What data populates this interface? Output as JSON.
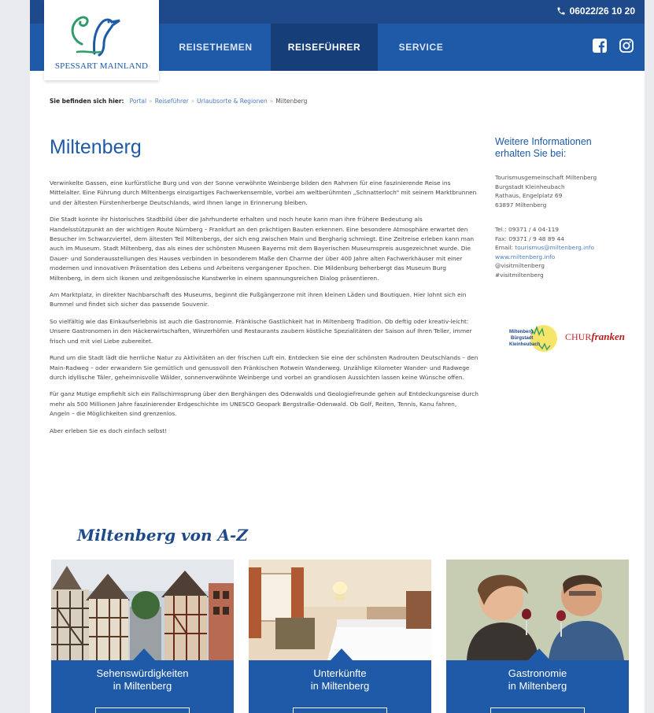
{
  "header": {
    "phone": "06022/26 10 20",
    "logo_text": "SPESSART MAINLAND",
    "nav": [
      {
        "label": "REISETHEMEN"
      },
      {
        "label": "REISEFÜHRER"
      },
      {
        "label": "SERVICE"
      }
    ],
    "icons": {
      "phone": "phone-icon",
      "facebook": "facebook-icon",
      "instagram": "instagram-icon"
    },
    "colors": {
      "topbar": "#1e4a8c",
      "navbar": "#1e5aa8",
      "active": "#163f7a"
    }
  },
  "breadcrumb": {
    "label": "Sie befinden sich hier:",
    "items": [
      "Portal",
      "Reiseführer",
      "Urlaubsorte & Regionen",
      "Miltenberg"
    ]
  },
  "main": {
    "title": "Miltenberg",
    "paragraphs": [
      "Verwinkelte Gassen, eine kurfürstliche Burg und von der Sonne verwöhnte Weinberge bilden den Rahmen für eine faszinierende Reise ins Mittelalter. Eine Führung durch Miltenbergs einzigartiges Fachwerkensemble, vorbei am weltberühmten „Schnatterloch\" mit seinem Marktbrunnen und der ältesten Fürstenherberge Deutschlands, wird Ihnen lange in Erinnerung bleiben.",
      "Die Stadt konnte ihr historisches Stadtbild über die Jahrhunderte erhalten und noch heute kann man ihre frühere Bedeutung als Handelsstützpunkt an der wichtigen Route Nürnberg – Frankfurt an den prächtigen Bauten erkennen. Eine besondere Atmosphäre erwartet den Besucher im Schwarzviertel, dem ältesten Teil Miltenbergs, der sich eng zwischen Main und Bergharig schmiegt. Eine Zeitreise erleben kann man auch im Museum. Stadt Miltenberg, das als eines der schönsten Museen Bayerns mit dem Bayerischen Museumspreis ausgezeichnet wurde. Die Dauer- und Sonderausstellungen des Hauses verbinden in besonderem Maße den Charme der über 400 Jahre alten Fachwerkhäuser mit einer modernen und innovativen Präsentation des Lebens und Arbeitens vergangener Epochen. Die Mildenburg beherbergt das Museum Burg Miltenberg, in dem sich Ikonen und zeitgenössische Kunstwerke in einem spannungsreichen Dialog präsentieren.",
      "Am Marktplatz, in direkter Nachbarschaft des Museums, beginnt die Fußgängerzone mit ihren kleinen Läden und Boutiquen. Hier lohnt sich ein Bummel und findet sich sicher das passende Souvenir.",
      "So vielfältig wie das Einkaufserlebnis ist auch die Gastronomie. Fränkische Gastlichkeit hat in Miltenberg Tradition. Ob deftig oder kreativ-leicht: Unsere Gastronomen in den Häckerwirtschaften, Winzerhöfen und Restaurants zaubern köstliche Spezialitäten der Saison auf Ihren Teller, immer frisch und mit viel Liebe zubereitet.",
      "Rund um die Stadt lädt die herrliche Natur zu Aktivitäten an der frischen Luft ein. Entdecken Sie eine der schönsten Radrouten Deutschlands – den Main-Radweg – oder erwandern Sie gemütlich und genussvoll den Fränkischen Rotwein Wanderweg. Unzählige Kilometer Wander- und Radwege durch idyllische Täler, geheimnisvolle Wälder, sonnenverwöhnte Weinberge und vorbei an grandiosen Aussichten lassen keine Wünsche offen.",
      "Für ganz Mutige empfiehlt sich ein Fallschirmsprung über den Berghängen des Odenwalds und Geologiefreunde gehen auf Entdeckungsreise durch mehr als 500 Millionen Jahre faszinierender Erdgeschichte im UNESCO Geopark Bergstraße-Odenwald. Ob Golf, Reiten, Tennis, Kanu fahren, Angeln – die Möglichkeiten sind grenzenlos.",
      "Aber erleben Sie es doch einfach selbst!"
    ]
  },
  "sidebar": {
    "title": "Weitere Informationen erhalten Sie bei:",
    "address": [
      "Tourismusgemeinschaft Miltenberg",
      "Burgstadt Kleinheubach",
      "Rathaus, Engelplatz 69",
      "63897 Miltenberg"
    ],
    "contact": {
      "tel": "Tel.: 09371 / 4 04-119",
      "fax": "Fax: 09371 / 9 48 89 44",
      "email_label": "Email:",
      "email": "tourismus@miltenberg.info",
      "web": "www.miltenberg.info",
      "handle1": "@visitmiltenberg",
      "handle2": "#visitmiltenberg"
    },
    "badge_text": [
      "Miltenberg",
      "Bürgstadt",
      "Kleinheubach"
    ],
    "partner_prefix": "CHUR",
    "partner_suffix": "franken"
  },
  "az": {
    "title": "Miltenberg von A-Z",
    "cards": [
      {
        "line1": "Sehenswürdigkeiten",
        "line2": "in Miltenberg"
      },
      {
        "line1": "Unterkünfte",
        "line2": "in Miltenberg"
      },
      {
        "line1": "Gastronomie",
        "line2": "in Miltenberg"
      }
    ]
  }
}
